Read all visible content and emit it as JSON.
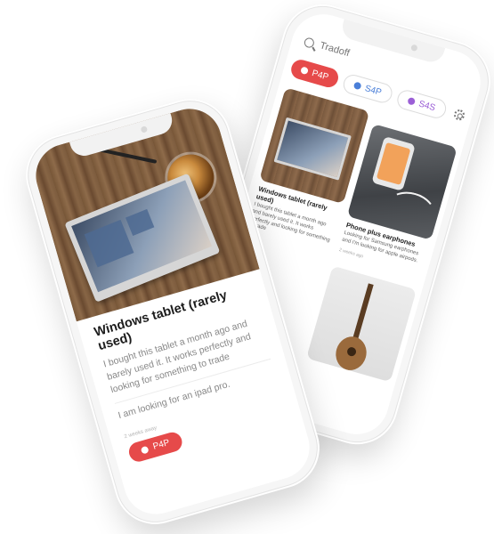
{
  "back_phone": {
    "search": {
      "placeholder": "Tradoff"
    },
    "filters": [
      {
        "label": "P4P"
      },
      {
        "label": "S4P"
      },
      {
        "label": "S4S"
      }
    ],
    "cards": [
      {
        "title": "Windows tablet (rarely used)",
        "text": "I bought this tablet a month ago and barely used it. It works perfectly and looking for something to trade",
        "time": ""
      },
      {
        "title": "Phone plus earphones",
        "text": "Looking for Samsung earphones and I'm looking for apple airpods.",
        "time": "2 weeks ago"
      }
    ]
  },
  "front_phone": {
    "title": "Windows tablet (rarely used)",
    "description": "I bought this tablet a month ago and barely used it. It works perfectly and looking for something to trade",
    "looking_for": "I am looking for an ipad pro.",
    "time_ago": "2 weeks away",
    "button_label": "P4P"
  },
  "colors": {
    "accent": "#e64a4a",
    "s4p": "#4a7fd8",
    "s4s": "#9b5fd6"
  }
}
